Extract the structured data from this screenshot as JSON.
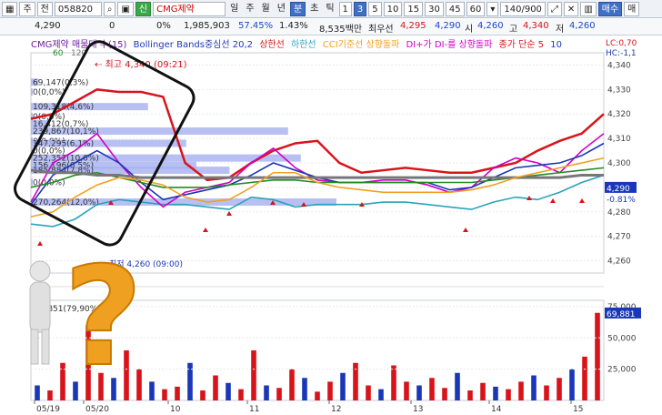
{
  "toolbar": {
    "market": "주",
    "type": "전",
    "code": "058820",
    "name": "CMG제약",
    "periods": [
      "일",
      "주",
      "월",
      "년",
      "분",
      "초",
      "틱"
    ],
    "minutes": [
      "1",
      "3",
      "5",
      "10",
      "15",
      "30",
      "45",
      "60"
    ],
    "selected_minute": "3",
    "count": "140/900",
    "buy": "매수",
    "sell": "매",
    "date": "05/20"
  },
  "info": {
    "price": "4,290",
    "change": "0",
    "change_pct": "0%",
    "volume": "1,985,903",
    "ratio": "57.45%",
    "turnover": "1.43%",
    "amount": "8,535백만",
    "best_sell_label": "최우선",
    "best_sell": "4,295",
    "best_buy": "4,290",
    "open_label": "시",
    "open": "4,260",
    "high_label": "고",
    "high": "4,340",
    "low_label": "저",
    "low": "4,260"
  },
  "legend": {
    "main": "CMG제약 매물대 수(15)",
    "bb": "Bollinger Bands중심선 20,2",
    "upper": "상한선",
    "lower": "하한선",
    "cci": "CCI기준선 상향돌파",
    "dmi": "DI+가 DI-를 상향돌파",
    "ma": "종가 단순 5",
    "ten": "10",
    "ma60": "60",
    "ma120": "120",
    "lc": "LC:0,70",
    "hc": "HC:-1,1"
  },
  "annotations": {
    "high_marker": "최고 4,340 (09:21)",
    "low_marker": "최저 4,260 (09:00)",
    "current_price": "4,290",
    "current_change": "-0.81%",
    "volume_current": "69,881",
    "volume_ratio_label": "69,851(79,90%)"
  },
  "chart_data": [
    {
      "type": "bar",
      "title": "",
      "volume_profile": [
        {
          "label": "69,147(0,3%)"
        },
        {
          "label": "0(0,0%)"
        },
        {
          "label": "109,318(4,6%)"
        },
        {
          "label": "0(0,0%)"
        },
        {
          "label": "16,412(0,7%)"
        },
        {
          "label": "239,867(10,1%)"
        },
        {
          "label": "0(0,0%)"
        },
        {
          "label": "147,295(6,1%)"
        },
        {
          "label": "0(0,0%)"
        },
        {
          "label": "252,352(10,6%)"
        },
        {
          "label": "156,196(6,5%)"
        },
        {
          "label": "185,884(7,8%)"
        },
        {
          "label": "0(0,0%)"
        },
        {
          "label": "270,264(12,0%)"
        }
      ],
      "y_ticks": [
        "4,340",
        "4,330",
        "4,320",
        "4,310",
        "4,300",
        "4,290",
        "4,280",
        "4,270",
        "4,260"
      ],
      "ylim": [
        4255,
        4345
      ],
      "x_ticks": [
        "05/19",
        "05/20",
        "10",
        "11",
        "12",
        "13",
        "14",
        "15"
      ],
      "series": [
        {
          "name": "상한선",
          "color": "#d8141a",
          "values": [
            4318,
            4320,
            4325,
            4330,
            4329,
            4329,
            4327,
            4300,
            4293,
            4294,
            4300,
            4305,
            4308,
            4309,
            4300,
            4296,
            4297,
            4298,
            4297,
            4296,
            4296,
            4298,
            4300,
            4305,
            4309,
            4312,
            4320
          ]
        },
        {
          "name": "하한선",
          "color": "#2aa3b8",
          "values": [
            4275,
            4274,
            4277,
            4283,
            4285,
            4284,
            4283,
            4283,
            4282,
            4281,
            4286,
            4285,
            4282,
            4283,
            4283,
            4283,
            4284,
            4284,
            4283,
            4282,
            4281,
            4284,
            4286,
            4285,
            4288,
            4292,
            4295
          ]
        },
        {
          "name": "종가 단순 5",
          "color": "#d100c8",
          "values": [
            4284,
            4300,
            4305,
            4312,
            4300,
            4290,
            4282,
            4288,
            4290,
            4292,
            4300,
            4306,
            4298,
            4293,
            4292,
            4292,
            4293,
            4293,
            4291,
            4288,
            4290,
            4298,
            4302,
            4300,
            4296,
            4305,
            4312
          ]
        },
        {
          "name": "10",
          "color": "#1a37b8",
          "values": [
            4283,
            4295,
            4300,
            4305,
            4300,
            4292,
            4285,
            4287,
            4289,
            4291,
            4295,
            4300,
            4297,
            4294,
            4292,
            4292,
            4292,
            4292,
            4292,
            4289,
            4290,
            4294,
            4298,
            4299,
            4300,
            4303,
            4308
          ]
        },
        {
          "name": "60",
          "color": "#228b22",
          "values": [
            4290,
            4292,
            4295,
            4296,
            4294,
            4292,
            4290,
            4290,
            4290,
            4291,
            4292,
            4293,
            4293,
            4292,
            4292,
            4292,
            4292,
            4292,
            4292,
            4292,
            4292,
            4293,
            4294,
            4295,
            4296,
            4297,
            4298
          ]
        },
        {
          "name": "120",
          "color": "#777777",
          "values": [
            4297,
            4296,
            4296,
            4295,
            4295,
            4294,
            4294,
            4294,
            4294,
            4294,
            4294,
            4294,
            4294,
            4294,
            4294,
            4294,
            4294,
            4294,
            4294,
            4294,
            4294,
            4294,
            4294,
            4294,
            4294,
            4295,
            4295
          ]
        },
        {
          "name": "Bollinger Bands중심선 20,2",
          "color": "#f0a020",
          "values": [
            4278,
            4280,
            4286,
            4291,
            4294,
            4293,
            4291,
            4286,
            4284,
            4285,
            4290,
            4296,
            4296,
            4292,
            4290,
            4289,
            4288,
            4288,
            4288,
            4288,
            4289,
            4291,
            4294,
            4296,
            4298,
            4300,
            4302
          ]
        }
      ]
    },
    {
      "type": "bar",
      "title": "",
      "y_ticks": [
        "75,000",
        "50,000",
        "25,000"
      ],
      "ylim": [
        0,
        80000
      ],
      "values": [
        12000,
        8000,
        30000,
        15000,
        60000,
        22000,
        18000,
        40000,
        25000,
        15000,
        9000,
        11000,
        30000,
        8000,
        20000,
        14000,
        9000,
        40000,
        12000,
        10000,
        25000,
        18000,
        7000,
        15000,
        22000,
        30000,
        12000,
        9000,
        28000,
        15000,
        12000,
        18000,
        10000,
        22000,
        8000,
        14000,
        11000,
        9000,
        15000,
        20000,
        12000,
        18000,
        25000,
        35000,
        70000
      ]
    }
  ]
}
